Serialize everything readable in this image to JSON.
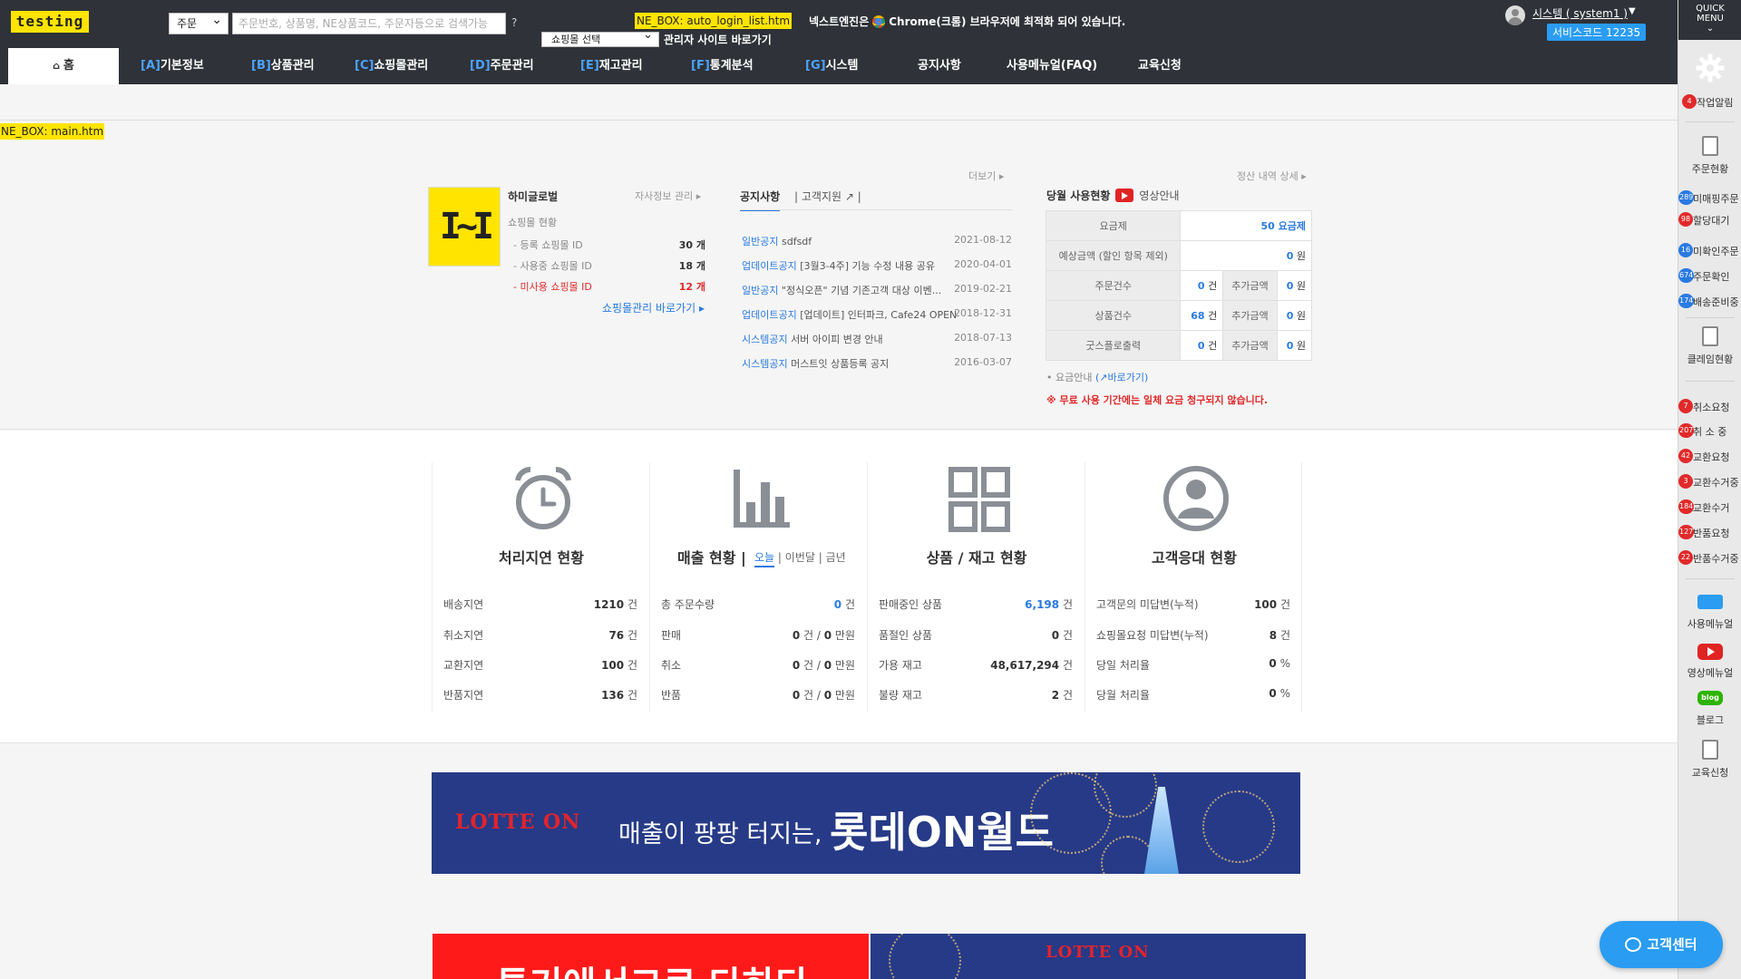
{
  "header": {
    "logo": "testing",
    "search_type": "주문",
    "search_placeholder": "주문번호, 상품명, NE상품코드, 주문자등으로 검색가능",
    "help": "?",
    "ne_box_top": "NE_BOX: auto_login_list.htm",
    "mall_select": "쇼핑몰 선택",
    "admin_shortcut": "관리자 사이트 바로가기",
    "engine_note_prefix": "넥스트엔진은",
    "engine_note_suffix": "Chrome(크롬) 브라우저에 최적화 되어 있습니다.",
    "user_name": "시스템 ( system1 )",
    "service_code": "서비스코드 12235"
  },
  "nav": {
    "home": "홈",
    "items": [
      {
        "code": "[A]",
        "label": "기본정보"
      },
      {
        "code": "[B]",
        "label": "상품관리"
      },
      {
        "code": "[C]",
        "label": "쇼핑몰관리"
      },
      {
        "code": "[D]",
        "label": "주문관리"
      },
      {
        "code": "[E]",
        "label": "재고관리"
      },
      {
        "code": "[F]",
        "label": "통계분석"
      },
      {
        "code": "[G]",
        "label": "시스템"
      },
      {
        "code": "",
        "label": "공지사항"
      },
      {
        "code": "",
        "label": "사용메뉴얼(FAQ)"
      },
      {
        "code": "",
        "label": "교육신청"
      }
    ]
  },
  "ne_box_main": "NE_BOX: main.htm",
  "company": {
    "name": "하미글로벌",
    "manage_link": "자사정보 관리 ▸",
    "mall_status_title": "쇼핑몰 현황",
    "rows": [
      {
        "label": "- 등록 쇼핑몰 ID",
        "value": "30 개"
      },
      {
        "label": "- 사용중 쇼핑몰 ID",
        "value": "18 개"
      },
      {
        "label": "- 미사용 쇼핑몰 ID",
        "value": "12 개"
      }
    ],
    "shortcut": "쇼핑몰관리 바로가기 ▸"
  },
  "notices": {
    "more": "더보기 ▸",
    "tab_notice": "공지사항",
    "tab_support": "고객지원",
    "items": [
      {
        "category": "일반공지",
        "title": " sdfsdf",
        "date": "2021-08-12"
      },
      {
        "category": "업데이트공지",
        "title": " [3월3-4주] 기능 수정 내용 공유",
        "date": "2020-04-01"
      },
      {
        "category": "일반공지",
        "title": " \"정식오픈\" 기념 기존고객 대상 이벤...",
        "date": "2019-02-21"
      },
      {
        "category": "업데이트공지",
        "title": " [업데이트] 인터파크, Cafe24 OPEN",
        "date": "2018-12-31"
      },
      {
        "category": "시스템공지",
        "title": " 서버 아이피 변경 안내",
        "date": "2018-07-13"
      },
      {
        "category": "시스템공지",
        "title": " 머스트잇 상품등록 공지",
        "date": "2016-03-07"
      }
    ]
  },
  "usage": {
    "settle_link": "정산 내역 상세 ▸",
    "title": "당월 사용현황",
    "video_guide": "영상안내",
    "plan_label": "요금제",
    "plan_num": "50",
    "plan_unit": " 요금제",
    "est_label": "예상금액 (할인 항목 제외)",
    "est_value": "0",
    "unit_won": " 원",
    "unit_count": " 건",
    "extra_label": "추가금액",
    "orders_label": "주문건수",
    "orders_value": "0",
    "products_label": "상품건수",
    "products_value": "68",
    "goods_label": "굿스플로출력",
    "goods_value": "0",
    "extra_values": [
      "0",
      "0",
      "0"
    ],
    "fee_guide": "• 요금안내",
    "fee_link": "(↗바로가기)",
    "fee_warning": "※ 무료 사용 기간에는 일체 요금 청구되지 않습니다."
  },
  "stats": {
    "delay": {
      "title": "처리지연 현황",
      "rows": [
        {
          "label": "배송지연",
          "value": "1210",
          "unit": " 건"
        },
        {
          "label": "취소지연",
          "value": "76",
          "unit": " 건"
        },
        {
          "label": "교환지연",
          "value": "100",
          "unit": " 건"
        },
        {
          "label": "반품지연",
          "value": "136",
          "unit": " 건"
        }
      ]
    },
    "sales": {
      "title": "매출 현황  |",
      "tab_today": "오늘",
      "tab_month": "이번달",
      "tab_year": "금년",
      "sep": "|",
      "rows": [
        {
          "label": "총 주문수량",
          "value": "0",
          "unit": " 건"
        },
        {
          "label": "판매",
          "count": "0",
          "amount": "0"
        },
        {
          "label": "취소",
          "count": "0",
          "amount": "0"
        },
        {
          "label": "반품",
          "count": "0",
          "amount": "0"
        }
      ],
      "count_unit": " 건  /  ",
      "amount_unit": " 만원"
    },
    "stock": {
      "title": "상품 / 재고 현황",
      "rows": [
        {
          "label": "판매중인 상품",
          "value": "6,198",
          "unit": " 건"
        },
        {
          "label": "품절인 상품",
          "value": "0",
          "unit": " 건"
        },
        {
          "label": "가용 재고",
          "value": "48,617,294",
          "unit": " 건"
        },
        {
          "label": "불량 재고",
          "value": "2",
          "unit": " 건"
        }
      ]
    },
    "cs": {
      "title": "고객응대 현황",
      "rows": [
        {
          "label": "고객문의 미답변(누적)",
          "value": "100",
          "unit": " 건"
        },
        {
          "label": "쇼핑몰요청 미답변(누적)",
          "value": "8",
          "unit": " 건"
        },
        {
          "label": "당일 처리율",
          "value": "0",
          "unit": " %"
        },
        {
          "label": "당월 처리율",
          "value": "0",
          "unit": " %"
        }
      ]
    }
  },
  "banners": {
    "lotte_logo": "LOTTE ON",
    "banner1_text": "매출이 팡팡 터지는, ",
    "banner1_strong": "롯데ON월드",
    "banner2_text": "투기에서그로 다하다"
  },
  "quick": {
    "head": "QUICK\nMENU",
    "task_alert": "작업알림",
    "task_alert_badge": "4",
    "order_status": "주문현황",
    "order_items": [
      {
        "badge": "289",
        "label": "미매핑주문",
        "blue": true
      },
      {
        "badge": "98",
        "label": "할당대기",
        "blue": false
      },
      {
        "badge": "16",
        "label": "미확인주문",
        "blue": true
      },
      {
        "badge": "674",
        "label": "주문확인",
        "blue": true
      },
      {
        "badge": "174",
        "label": "배송준비중",
        "blue": true
      }
    ],
    "claim_status": "클레임현황",
    "claim_items": [
      {
        "badge": "7",
        "label": "취소요청"
      },
      {
        "badge": "207",
        "label": "취 소 중"
      },
      {
        "badge": "42",
        "label": "교환요청"
      },
      {
        "badge": "3",
        "label": "교환수거중"
      },
      {
        "badge": "184",
        "label": "교환수거"
      },
      {
        "badge": "127",
        "label": "반품요청"
      },
      {
        "badge": "22",
        "label": "반품수거중"
      }
    ],
    "manual": "사용메뉴얼",
    "video_manual": "영상메뉴얼",
    "blog": "블로그",
    "blog_tag": "blog",
    "education": "교육신청"
  },
  "cs_button": "고객센터",
  "colors": {
    "accent": "#2a7ae2",
    "danger": "#e12a2a",
    "logo_bg": "#ffe400",
    "topbar": "#2f3238",
    "banner_navy": "#263a87"
  }
}
